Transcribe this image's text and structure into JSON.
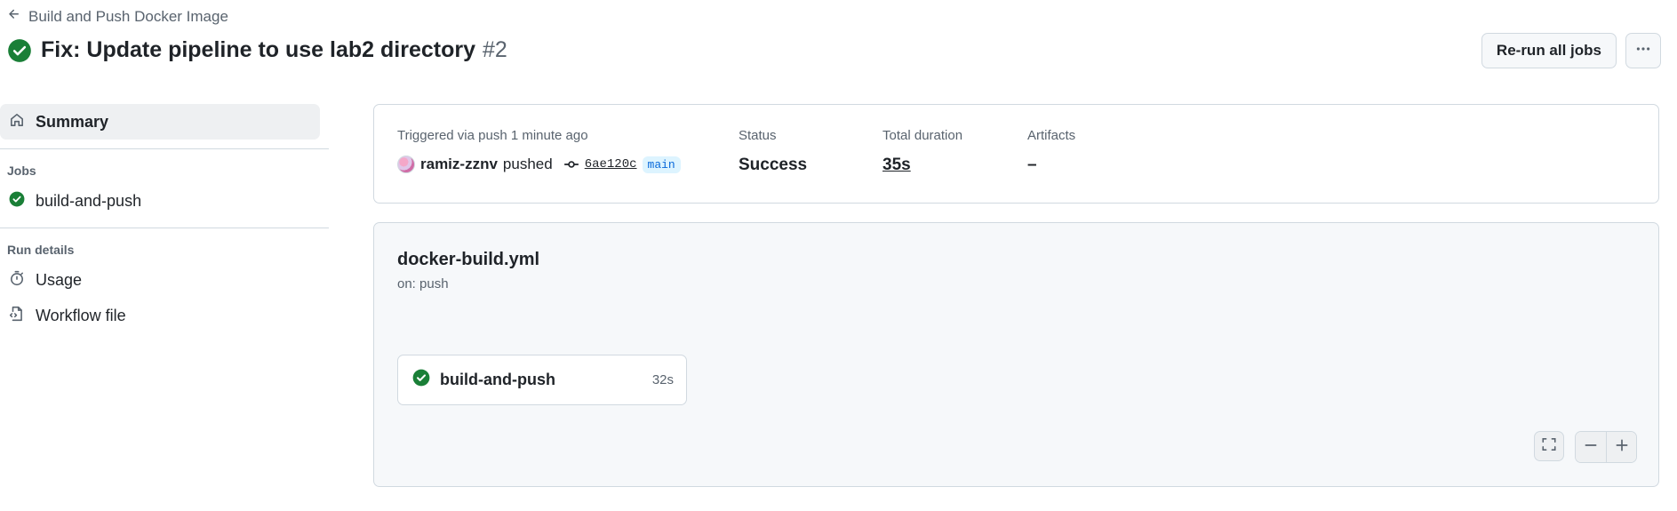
{
  "header": {
    "back_label": "Build and Push Docker Image",
    "title": "Fix: Update pipeline to use lab2 directory",
    "run_number": "#2",
    "rerun_label": "Re-run all jobs",
    "status_color": "#1a7f37"
  },
  "sidebar": {
    "summary_label": "Summary",
    "jobs_heading": "Jobs",
    "jobs": [
      {
        "label": "build-and-push"
      }
    ],
    "run_details_heading": "Run details",
    "usage_label": "Usage",
    "workflow_file_label": "Workflow file"
  },
  "summary": {
    "trigger_text": "Triggered via push 1 minute ago",
    "actor": "ramiz-zznv",
    "action": "pushed",
    "commit": "6ae120c",
    "branch": "main",
    "status_label": "Status",
    "status_value": "Success",
    "duration_label": "Total duration",
    "duration_value": "35s",
    "artifacts_label": "Artifacts",
    "artifacts_value": "–"
  },
  "workflow": {
    "file_name": "docker-build.yml",
    "trigger": "on: push",
    "job": {
      "name": "build-and-push",
      "duration": "32s"
    }
  }
}
